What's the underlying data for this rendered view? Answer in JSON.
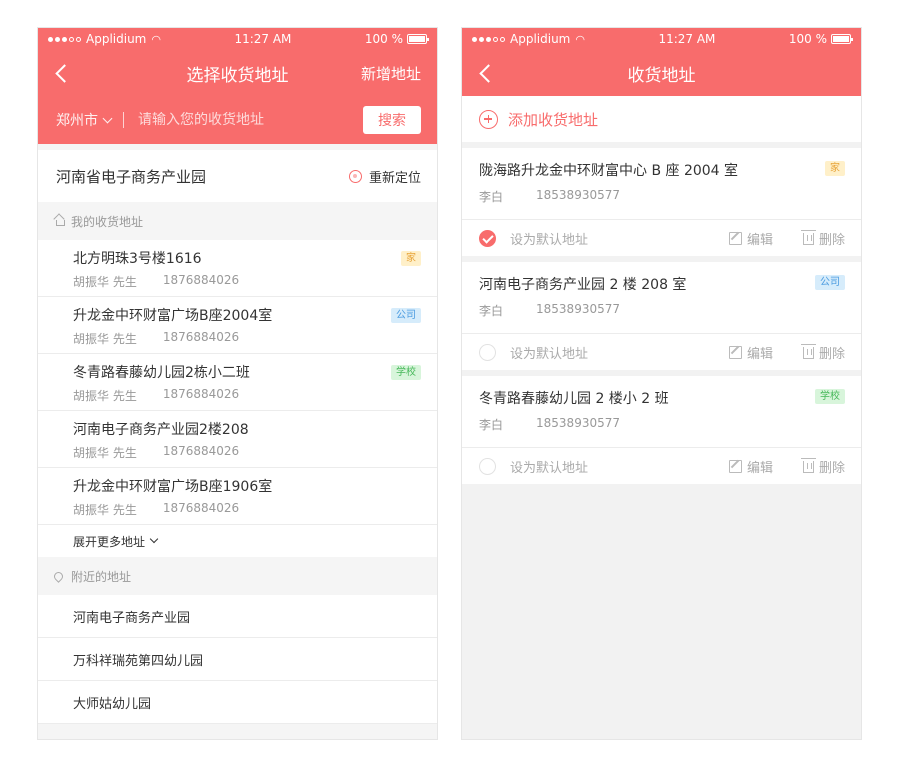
{
  "colors": {
    "accent": "#f86c6c",
    "tag_home": "#e7a338",
    "tag_company": "#4a9be0",
    "tag_school": "#47b85a"
  },
  "left": {
    "status": {
      "carrier": "Applidium",
      "time": "11:27 AM",
      "battery": "100 %"
    },
    "nav": {
      "title": "选择收货地址",
      "right_action": "新增地址",
      "back_icon": "back-arrow-icon"
    },
    "search": {
      "city": "郑州市",
      "placeholder": "请输入您的收货地址",
      "button": "搜索"
    },
    "current_location": {
      "name": "河南省电子商务产业园",
      "relocate": "重新定位"
    },
    "my_addresses": {
      "title": "我的收货地址",
      "items": [
        {
          "address": "北方明珠3号楼1616",
          "name": "胡振华 先生",
          "phone": "1876884026",
          "tag": "家"
        },
        {
          "address": "升龙金中环财富广场B座2004室",
          "name": "胡振华 先生",
          "phone": "1876884026",
          "tag": "公司"
        },
        {
          "address": "冬青路春藤幼儿园2栋小二班",
          "name": "胡振华 先生",
          "phone": "1876884026",
          "tag": "学校"
        },
        {
          "address": "河南电子商务产业园2楼208",
          "name": "胡振华 先生",
          "phone": "1876884026",
          "tag": ""
        },
        {
          "address": "升龙金中环财富广场B座1906室",
          "name": "胡振华 先生",
          "phone": "1876884026",
          "tag": ""
        }
      ],
      "expand": "展开更多地址"
    },
    "nearby": {
      "title": "附近的地址",
      "items": [
        "河南电子商务产业园",
        "万科祥瑞苑第四幼儿园",
        "大师姑幼儿园"
      ]
    }
  },
  "right": {
    "status": {
      "carrier": "Applidium",
      "time": "11:27 AM",
      "battery": "100 %"
    },
    "nav": {
      "title": "收货地址"
    },
    "add_label": "添加收货地址",
    "set_default": "设为默认地址",
    "edit": "编辑",
    "delete": "删除",
    "cards": [
      {
        "address": "陇海路升龙金中环财富中心 B 座 2004 室",
        "name": "李白",
        "phone": "18538930577",
        "tag": "家",
        "default": true
      },
      {
        "address": "河南电子商务产业园 2 楼 208 室",
        "name": "李白",
        "phone": "18538930577",
        "tag": "公司",
        "default": false
      },
      {
        "address": "冬青路春藤幼儿园 2 楼小 2 班",
        "name": "李白",
        "phone": "18538930577",
        "tag": "学校",
        "default": false
      }
    ]
  }
}
